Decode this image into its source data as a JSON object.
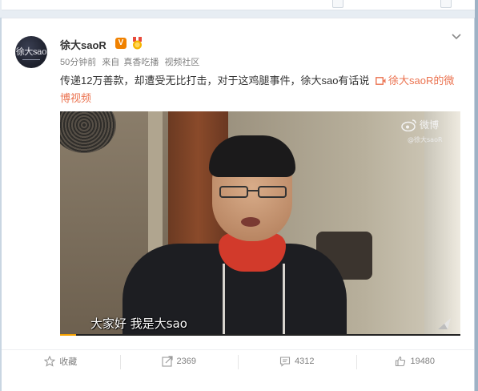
{
  "post": {
    "author": "徐大saoR",
    "avatar_text": "徐大sao",
    "meta": {
      "time": "50分钟前",
      "source_prefix": "来自",
      "source": "真香吃播",
      "community": "视频社区"
    },
    "text": "传递12万善款，却遭受无比打击，对于这鸡腿事件，徐大sao有话说",
    "link_label": "徐大saoR的微博视频",
    "video": {
      "watermark": "微博",
      "watermark_user": "@徐大saoR",
      "subtitle": "大家好 我是大sao",
      "progress": 0.04
    },
    "actions": {
      "favorite": "收藏",
      "repost": "2369",
      "comment": "4312",
      "like": "19480"
    }
  },
  "colors": {
    "accent_link": "#eb7350",
    "vip_badge": "#f08100",
    "progress": "#f7a200"
  },
  "icons": [
    "v-verified-icon",
    "medal-icon",
    "chevron-down-icon",
    "video-link-icon",
    "weibo-logo-icon",
    "star-icon",
    "repost-icon",
    "comment-icon",
    "thumbs-up-icon",
    "fullscreen-icon"
  ]
}
